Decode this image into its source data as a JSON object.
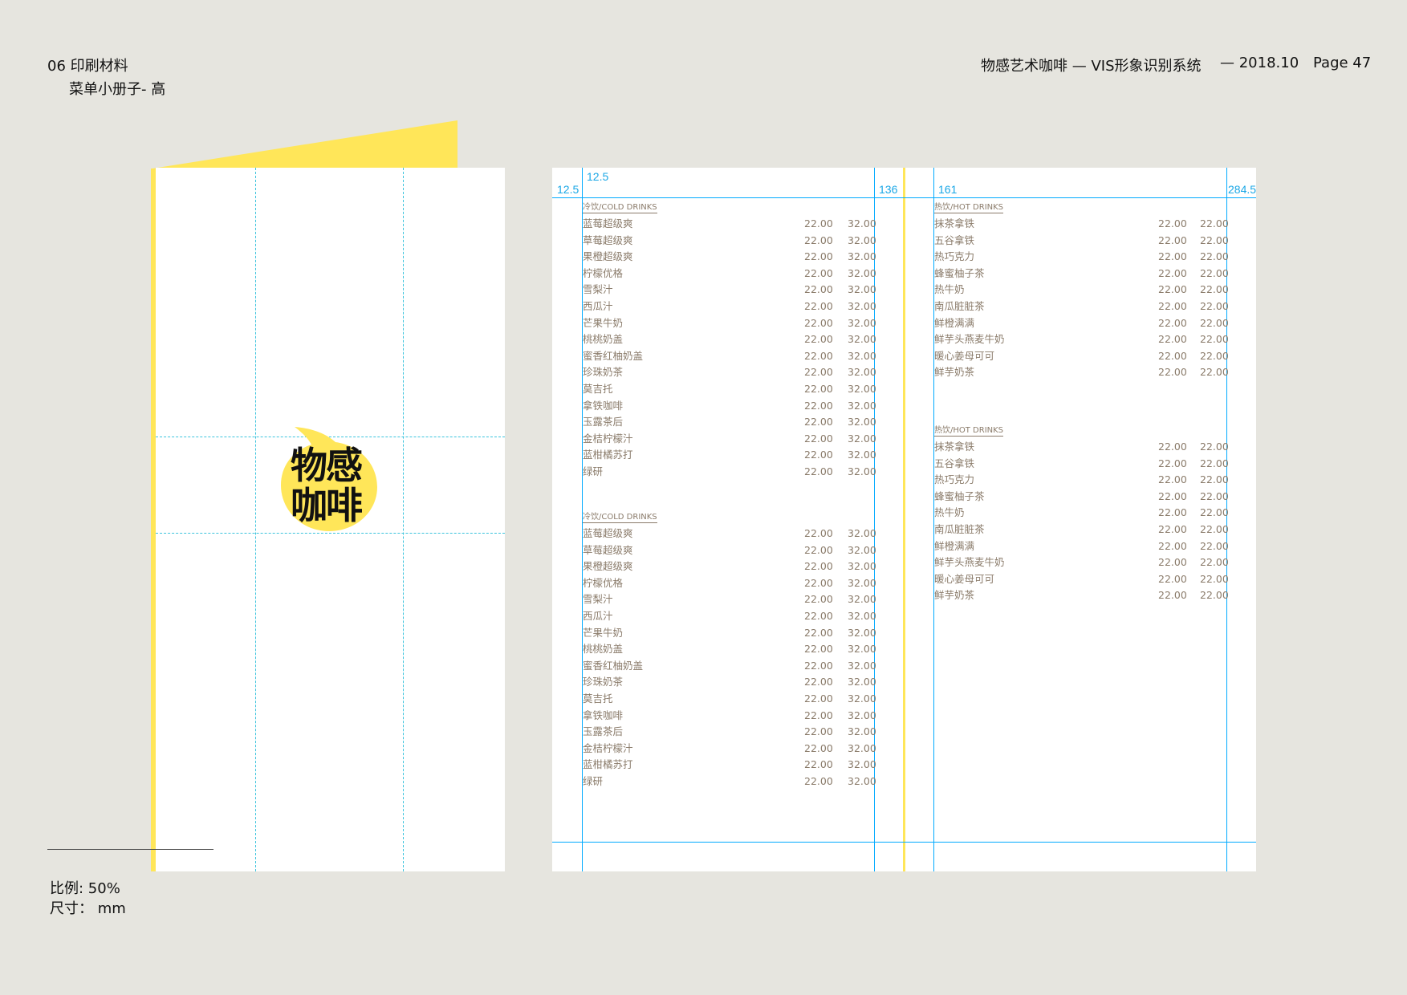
{
  "header": {
    "section": "06 印刷材料",
    "subsection": "菜单小册子- 高",
    "title": "物感艺术咖啡 — VIS形象识别系统",
    "date": "— 2018.10",
    "page": "Page 47"
  },
  "footer": {
    "scale_label": "比例: 50%",
    "size_label": "尺寸： mm"
  },
  "cover": {
    "logo_text_line1": "物感",
    "logo_text_line2": "咖啡",
    "brand_color": "#ffe659"
  },
  "dimensions": {
    "left_margin": "12.5",
    "top_margin": "12.5",
    "fold": "136",
    "right_col_start": "161",
    "right_edge": "284.5"
  },
  "colors": {
    "guide": "#00aaff",
    "text": "#8a7b6a",
    "yellow": "#ffe659"
  },
  "menu": {
    "col1_sec1_title": "冷饮/COLD DRINKS",
    "col1_sec2_title": "冷饮/COLD DRINKS",
    "col2_sec1_title": "热饮/HOT DRINKS",
    "col2_sec2_title": "热饮/HOT DRINKS",
    "cold_items": [
      {
        "name": "蓝莓超级爽",
        "p1": "22.00",
        "p2": "32.00"
      },
      {
        "name": "草莓超级爽",
        "p1": "22.00",
        "p2": "32.00"
      },
      {
        "name": "果橙超级爽",
        "p1": "22.00",
        "p2": "32.00"
      },
      {
        "name": "柠檬优格",
        "p1": "22.00",
        "p2": "32.00"
      },
      {
        "name": "雪梨汁",
        "p1": "22.00",
        "p2": "32.00"
      },
      {
        "name": "西瓜汁",
        "p1": "22.00",
        "p2": "32.00"
      },
      {
        "name": "芒果牛奶",
        "p1": "22.00",
        "p2": "32.00"
      },
      {
        "name": "桃桃奶盖",
        "p1": "22.00",
        "p2": "32.00"
      },
      {
        "name": "蜜香红柚奶盖",
        "p1": "22.00",
        "p2": "32.00"
      },
      {
        "name": "珍珠奶茶",
        "p1": "22.00",
        "p2": "32.00"
      },
      {
        "name": "莫吉托",
        "p1": "22.00",
        "p2": "32.00"
      },
      {
        "name": "拿铁咖啡",
        "p1": "22.00",
        "p2": "32.00"
      },
      {
        "name": "玉露茶后",
        "p1": "22.00",
        "p2": "32.00"
      },
      {
        "name": "金桔柠檬汁",
        "p1": "22.00",
        "p2": "32.00"
      },
      {
        "name": "蓝柑橘苏打",
        "p1": "22.00",
        "p2": "32.00"
      },
      {
        "name": "绿研",
        "p1": "22.00",
        "p2": "32.00"
      }
    ],
    "hot_items": [
      {
        "name": "抹茶拿铁",
        "p1": "22.00",
        "p2": "22.00"
      },
      {
        "name": "五谷拿铁",
        "p1": "22.00",
        "p2": "22.00"
      },
      {
        "name": "热巧克力",
        "p1": "22.00",
        "p2": "22.00"
      },
      {
        "name": "蜂蜜柚子茶",
        "p1": "22.00",
        "p2": "22.00"
      },
      {
        "name": "热牛奶",
        "p1": "22.00",
        "p2": "22.00"
      },
      {
        "name": "南瓜脏脏茶",
        "p1": "22.00",
        "p2": "22.00"
      },
      {
        "name": "鲜橙满满",
        "p1": "22.00",
        "p2": "22.00"
      },
      {
        "name": "鲜芋头燕麦牛奶",
        "p1": "22.00",
        "p2": "22.00"
      },
      {
        "name": "暖心姜母可可",
        "p1": "22.00",
        "p2": "22.00"
      },
      {
        "name": "鲜芋奶茶",
        "p1": "22.00",
        "p2": "22.00"
      }
    ]
  }
}
